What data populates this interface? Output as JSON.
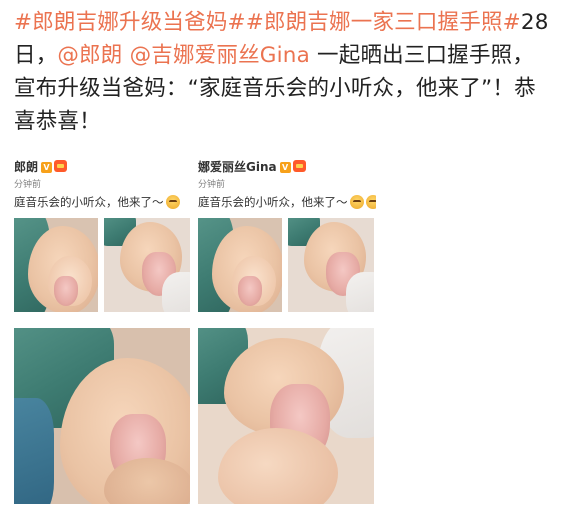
{
  "post": {
    "hashtag1": "#郎朗吉娜升级当爸妈#",
    "hashtag2": "#郎朗吉娜一家三口握手照#",
    "lead": "28日，",
    "mention1": "@郎朗",
    "mention2": "@吉娜爱丽丝Gina",
    "body": "一起晒出三口握手照，宣布升级当爸妈：“家庭音乐会的小听众，他来了”！恭喜恭喜！"
  },
  "screenshots": [
    {
      "name": "郎朗",
      "vip_badge": "V",
      "time": "分钟前",
      "text": "庭音乐会的小听众，他来了～"
    },
    {
      "name": "娜爱丽丝Gina",
      "vip_badge": "V",
      "time": "分钟前",
      "text": "庭音乐会的小听众，他来了～"
    }
  ],
  "colors": {
    "link": "#eb7350",
    "text": "#222222",
    "vip_badge": "#f7a11a"
  },
  "icons": [
    "verified-v-icon",
    "member-badge-icon",
    "emoji-icon"
  ]
}
